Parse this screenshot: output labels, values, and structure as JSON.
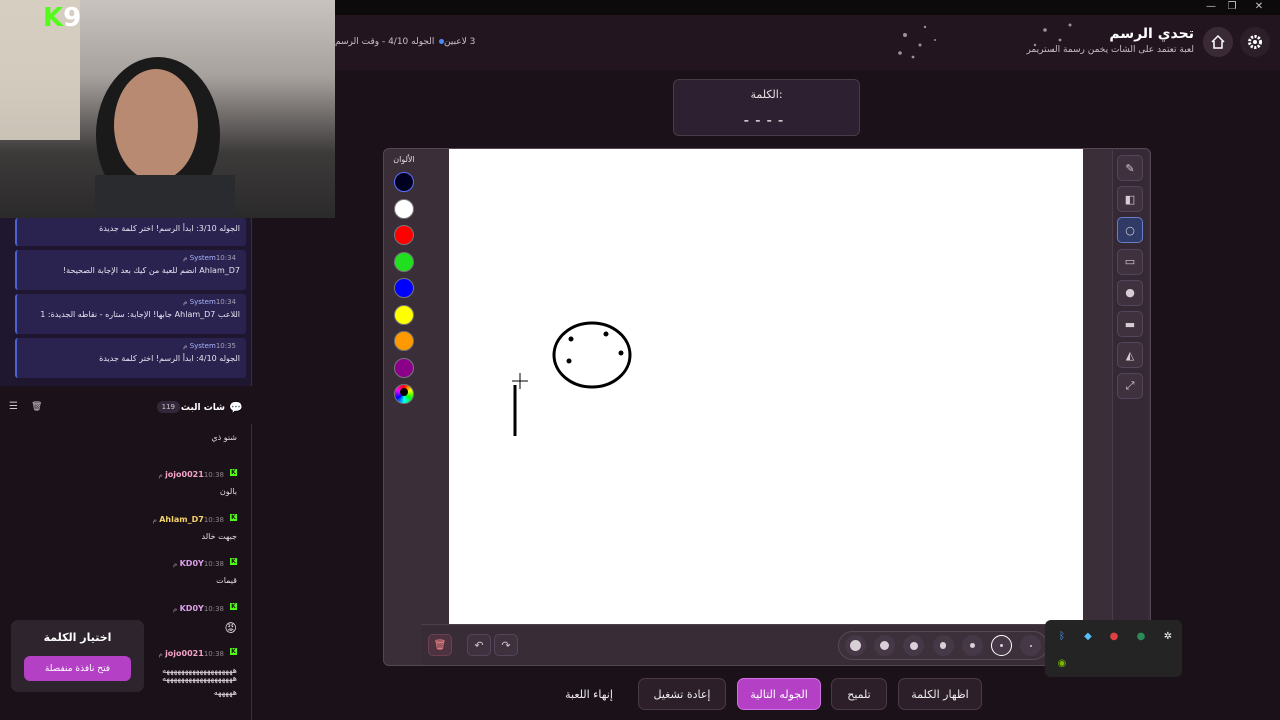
{
  "brand": {
    "logo_letter": "K",
    "logo_number": "9"
  },
  "header": {
    "title": "تحدي الرسم",
    "subtitle": "لعبة تعتمد على الشات يخمن رسمة الستريمر",
    "round_info": "الجوله 4/10 - وقت الرسم",
    "players": "3 لاعبين"
  },
  "word": {
    "label": "الكلمة:",
    "blanks": "----"
  },
  "palette": {
    "title": "الألوان",
    "colors": [
      "#000020",
      "#ffffff",
      "#ff0000",
      "#1fdf1f",
      "#0000ff",
      "#ffff00",
      "#ff9900",
      "#8a008a",
      "multicolor"
    ]
  },
  "tools": [
    "pencil-icon",
    "eraser-icon",
    "circle-outline-icon",
    "rectangle-outline-icon",
    "filled-circle-icon",
    "filled-rectangle-icon",
    "fill-bucket-icon",
    "line-icon"
  ],
  "brush_sizes": {
    "count": 7,
    "selected_index": 5
  },
  "buttons": {
    "show_word": "اظهار الكلمة",
    "hint": "تلميح",
    "next_round": "الجوله التالية",
    "restart": "إعادة تشغيل",
    "end_game": "إنهاء اللعبة"
  },
  "system_feed": [
    {
      "text": "الجوله 3/10: ابدأ الرسم! اختر كلمة جديدة"
    },
    {
      "author": "System",
      "time": "10:34 م",
      "text": "Ahlam_D7 انضم للعبة من كيك بعد الإجابة الصحيحة!"
    },
    {
      "author": "System",
      "time": "10:34 م",
      "text": "اللاعب Ahlam_D7 جابها! الإجابة: ستاره - نقاطه الجديدة: 1"
    },
    {
      "author": "System",
      "time": "10:35 م",
      "text": "الجوله 4/10: ابدأ الرسم! اختر كلمة جديدة"
    }
  ],
  "chat": {
    "title": "شات البث",
    "count": "119",
    "messages": [
      {
        "author": "",
        "time": "",
        "text": "شنو ذي"
      },
      {
        "author": "jojo0021",
        "time": "10:38 م",
        "text": "بالون",
        "color": "#f5a3c8"
      },
      {
        "author": "Ahlam_D7",
        "time": "10:38 م",
        "text": "جبهت خالد",
        "color": "#f5d36a"
      },
      {
        "author": "KD0Y",
        "time": "10:38 م",
        "text": "قيمات",
        "color": "#d9a0e8"
      },
      {
        "author": "KD0Y",
        "time": "10:38 م",
        "text": "😡",
        "color": "#d9a0e8"
      },
      {
        "author": "jojo0021",
        "time": "10:38 م",
        "text": "هههههههههههههههههههه",
        "color": "#f5a3c8"
      },
      {
        "author": "",
        "time": "",
        "text": "هههههههههههههههههههه"
      },
      {
        "author": "",
        "time": "",
        "text": "هههههه"
      }
    ]
  },
  "word_picker": {
    "title": "اختيار الكلمة",
    "button": "فتح نافذة منفصلة"
  },
  "window_controls": [
    "—",
    "❐",
    "✕"
  ]
}
